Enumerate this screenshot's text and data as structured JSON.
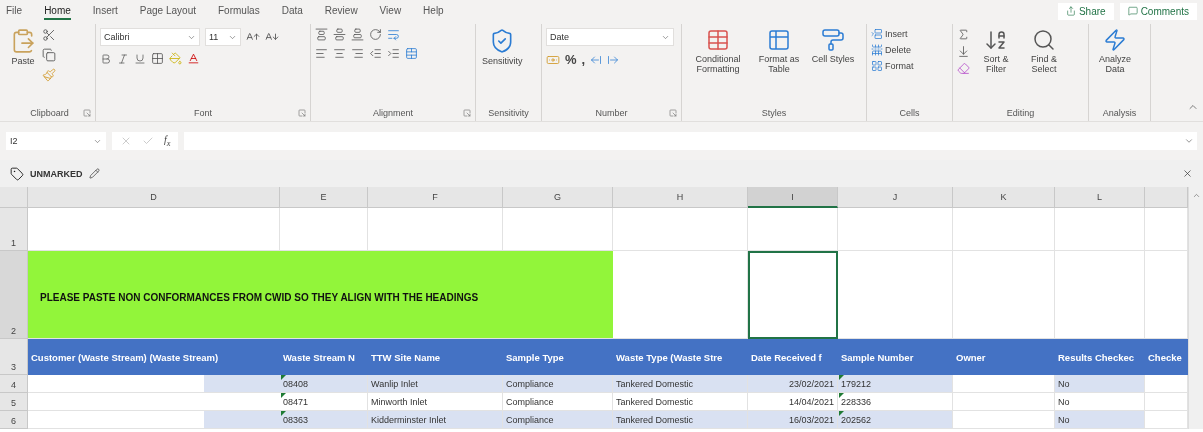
{
  "menu": {
    "tabs": [
      {
        "label": "File",
        "selected": false
      },
      {
        "label": "Home",
        "selected": true
      },
      {
        "label": "Insert",
        "selected": false
      },
      {
        "label": "Page Layout",
        "selected": false
      },
      {
        "label": "Formulas",
        "selected": false
      },
      {
        "label": "Data",
        "selected": false
      },
      {
        "label": "Review",
        "selected": false
      },
      {
        "label": "View",
        "selected": false
      },
      {
        "label": "Help",
        "selected": false
      }
    ],
    "share": "Share",
    "comments": "Comments"
  },
  "ribbon": {
    "clipboard": {
      "paste": "Paste",
      "label": "Clipboard"
    },
    "font": {
      "name": "Calibri",
      "size": "11",
      "label": "Font"
    },
    "alignment": {
      "label": "Alignment"
    },
    "sensitivity": {
      "button": "Sensitivity",
      "label": "Sensitivity"
    },
    "number": {
      "format": "Date",
      "percent": "%",
      "comma": ",",
      "label": "Number"
    },
    "styles": {
      "buttons": [
        "Conditional Formatting",
        "Format as Table",
        "Cell Styles"
      ],
      "label": "Styles"
    },
    "cells": {
      "buttons": [
        "Insert",
        "Delete",
        "Format"
      ],
      "label": "Cells"
    },
    "editing": {
      "buttons": [
        "Sort & Filter",
        "Find & Select"
      ],
      "label": "Editing"
    },
    "analysis": {
      "button": "Analyze Data",
      "label": "Analysis"
    }
  },
  "formula_bar": {
    "name_box": "I2",
    "fx": "f$_{x}$"
  },
  "sensitivity_bar": {
    "label": "UNMARKED"
  },
  "sheet": {
    "columns": [
      {
        "letter": "D",
        "selected": false
      },
      {
        "letter": "E",
        "selected": false
      },
      {
        "letter": "F",
        "selected": false
      },
      {
        "letter": "G",
        "selected": false
      },
      {
        "letter": "H",
        "selected": false
      },
      {
        "letter": "I",
        "selected": true
      },
      {
        "letter": "J",
        "selected": false
      },
      {
        "letter": "K",
        "selected": false
      },
      {
        "letter": "L",
        "selected": false
      }
    ],
    "rows": [
      {
        "number": "1",
        "selected": false
      },
      {
        "number": "2",
        "selected": true
      }
    ],
    "notice": "PLEASE PASTE NON CONFORMANCES FROM CWID SO THEY ALIGN WITH THE HEADINGS",
    "header_row": {
      "number": "3",
      "headers": [
        "Customer (Waste Stream) (Waste Stream)",
        "Waste Stream N",
        "TTW Site Name",
        "Sample Type",
        "Waste Type (Waste Stre",
        "Date Received f",
        "Sample Number",
        "Owner",
        "Results Checkec",
        "Checke"
      ]
    },
    "data_rows": [
      {
        "number": "4",
        "waste_stream_no": "08408",
        "site": "Wanlip Inlet",
        "sample_type": "Compliance",
        "waste_type": "Tankered Domestic",
        "date_received": "23/02/2021",
        "sample_number": "179212",
        "results_checked": "No",
        "flagged": true
      },
      {
        "number": "5",
        "waste_stream_no": "08471",
        "site": "Minworth Inlet",
        "sample_type": "Compliance",
        "waste_type": "Tankered Domestic",
        "date_received": "14/04/2021",
        "sample_number": "228336",
        "results_checked": "No",
        "flagged": true
      },
      {
        "number": "6",
        "waste_stream_no": "08363",
        "site": "Kidderminster Inlet",
        "sample_type": "Compliance",
        "waste_type": "Tankered Domestic",
        "date_received": "16/03/2021",
        "sample_number": "202562",
        "results_checked": "No",
        "flagged": true
      }
    ]
  }
}
